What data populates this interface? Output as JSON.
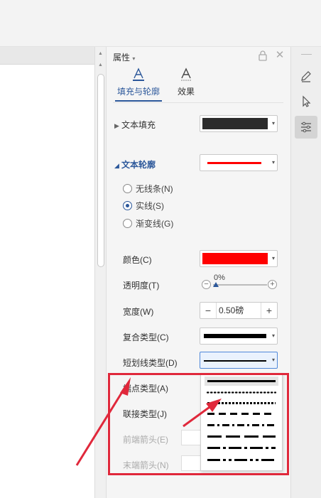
{
  "panel": {
    "title": "属性",
    "tabs": [
      {
        "label": "填充与轮廓",
        "active": true
      },
      {
        "label": "效果",
        "active": false
      }
    ]
  },
  "text_fill": {
    "label": "文本填充",
    "color": "#2b2b2b"
  },
  "text_outline": {
    "label": "文本轮廓",
    "color": "#ff0000",
    "options": [
      {
        "label": "无线条(N)",
        "checked": false
      },
      {
        "label": "实线(S)",
        "checked": true
      },
      {
        "label": "渐变线(G)",
        "checked": false
      }
    ]
  },
  "props": {
    "color_label": "颜色(C)",
    "color_value": "#ff0000",
    "transparency_label": "透明度(T)",
    "transparency_value": "0%",
    "width_label": "宽度(W)",
    "width_value": "0.50磅",
    "compound_label": "复合类型(C)",
    "dash_label": "短划线类型(D)",
    "cap_label": "端点类型(A)",
    "join_label": "联接类型(J)",
    "start_arrow_label": "前端箭头(E)",
    "end_arrow_label": "末端箭头(N)"
  },
  "dash_options": [
    "solid",
    "round-dot",
    "square-dot",
    "dash",
    "dash-dot",
    "long-dash",
    "long-dash-dot",
    "long-dash-dot-dot"
  ],
  "dash_selected": "solid",
  "colors": {
    "accent": "#2b579a",
    "highlight": "#e0283b",
    "outline": "#ff0000"
  },
  "side_icons": [
    "pen-icon",
    "cursor-icon",
    "sliders-icon"
  ]
}
